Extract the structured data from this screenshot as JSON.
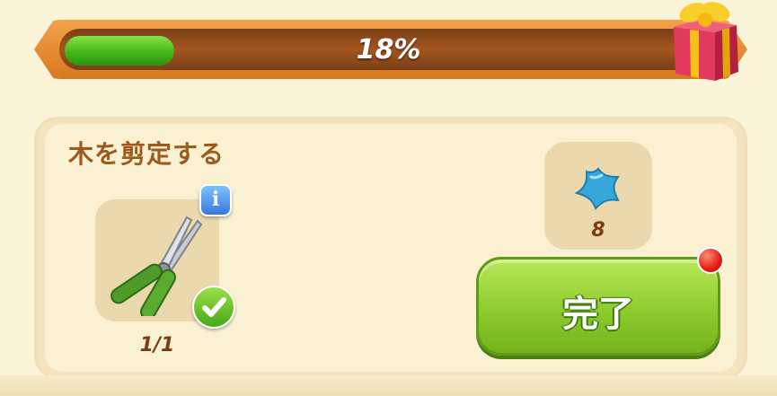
{
  "progress": {
    "value_percent": 18,
    "label": "18%"
  },
  "task": {
    "title": "木を剪定する",
    "tool_icon": "pruning-shears-icon",
    "tool_count": "1/1",
    "tool_status_icon": "check-icon",
    "info_icon": "info-icon"
  },
  "reward": {
    "icon": "blue-star-icon",
    "count": "8"
  },
  "complete_button": {
    "label": "完了",
    "has_notification": true
  },
  "colors": {
    "progress_fill": "#45b719",
    "button_green": "#8dcc2c",
    "title_brown": "#9c5a1d",
    "notification_red": "#e51c12"
  }
}
